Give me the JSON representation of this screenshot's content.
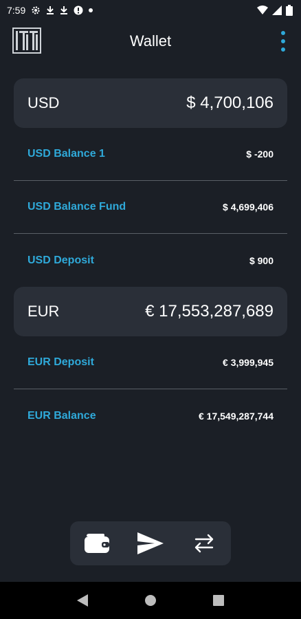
{
  "status_bar": {
    "time": "7:59",
    "icons_left": [
      "settings-icon",
      "download-icon",
      "download-icon",
      "alert-icon",
      "dot-icon"
    ],
    "icons_right": [
      "wifi-icon",
      "cellular-icon",
      "battery-icon"
    ]
  },
  "app_bar": {
    "title": "Wallet",
    "logo_icon": "app-logo-icon",
    "menu_icon": "more-vert-icon"
  },
  "wallets": [
    {
      "code": "USD",
      "total": "$ 4,700,106",
      "accounts": [
        {
          "name": "USD Balance 1",
          "amount": "$ -200"
        },
        {
          "name": "USD Balance Fund",
          "amount": "$ 4,699,406"
        },
        {
          "name": "USD Deposit",
          "amount": "$ 900"
        }
      ]
    },
    {
      "code": "EUR",
      "total": "€ 17,553,287,689",
      "accounts": [
        {
          "name": "EUR Deposit",
          "amount": "€ 3,999,945"
        },
        {
          "name": "EUR Balance",
          "amount": "€ 17,549,287,744"
        }
      ]
    }
  ],
  "bottom_nav": [
    "wallet-icon",
    "send-icon",
    "transfer-icon"
  ],
  "system_nav": [
    "back-icon",
    "home-icon",
    "recents-icon"
  ],
  "colors": {
    "background": "#1b1f26",
    "card": "#2a2f38",
    "accent": "#2fa9d9",
    "text": "#ffffff"
  }
}
